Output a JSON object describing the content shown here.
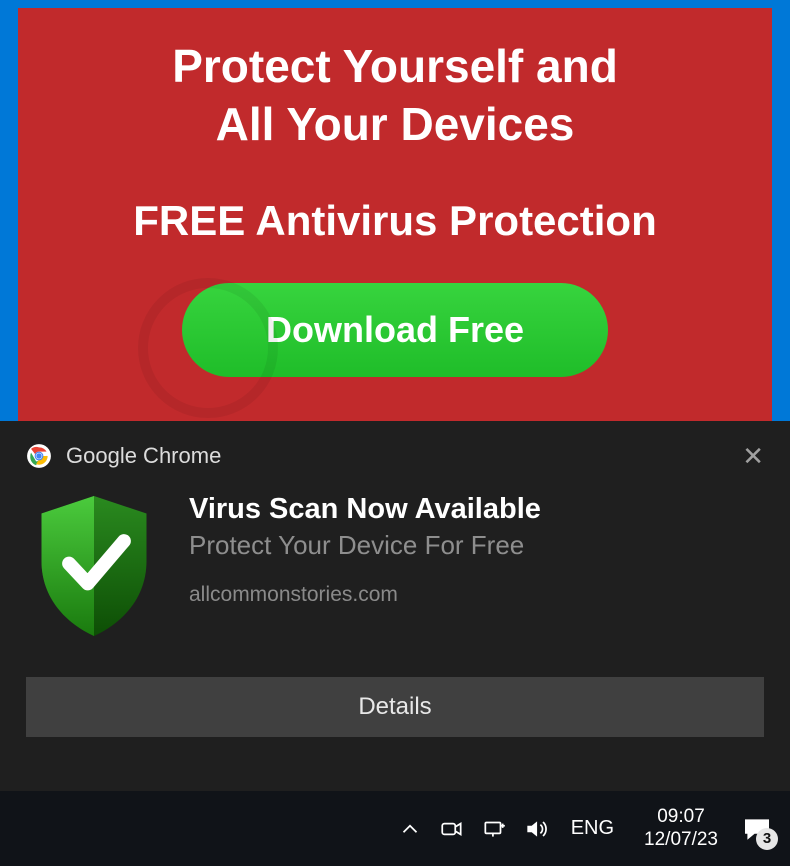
{
  "banner": {
    "title_line1": "Protect Yourself and",
    "title_line2": "All Your Devices",
    "subtitle": "FREE Antivirus Protection",
    "button_label": "Download Free"
  },
  "notification": {
    "app_name": "Google Chrome",
    "title": "Virus Scan Now Available",
    "description": "Protect Your Device For Free",
    "source": "allcommonstories.com",
    "action_label": "Details"
  },
  "taskbar": {
    "language": "ENG",
    "time": "09:07",
    "date": "12/07/23",
    "badge_count": "3"
  }
}
